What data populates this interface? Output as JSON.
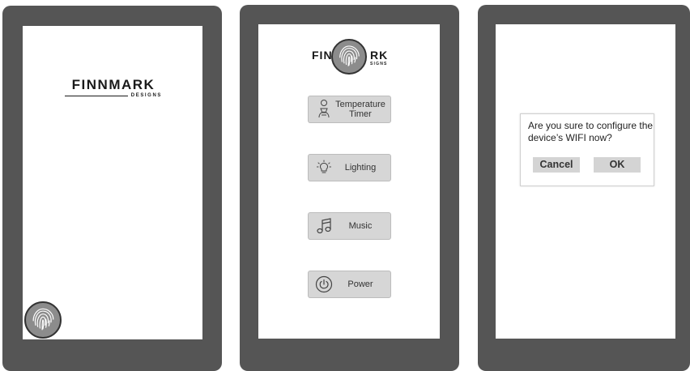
{
  "screens": {
    "splash": {
      "logo": {
        "main": "FINNMARK",
        "sub": "DESIGNS"
      },
      "fingerprint_icon": "fingerprint-icon"
    },
    "menu": {
      "logo": {
        "left": "FIN",
        "right": "RK",
        "sub": "SIGNS"
      },
      "fingerprint_icon": "fingerprint-icon",
      "buttons": [
        {
          "label_line1": "Temperature",
          "label_line2": "Timer",
          "icon": "thermometer-icon"
        },
        {
          "label": "Lighting",
          "icon": "lightbulb-icon"
        },
        {
          "label": "Music",
          "icon": "music-note-icon"
        },
        {
          "label": "Power",
          "icon": "power-icon"
        }
      ]
    },
    "dialog": {
      "message": "Are you sure to configure the device’s WIFI now?",
      "cancel_label": "Cancel",
      "ok_label": "OK"
    }
  },
  "colors": {
    "device_frame": "#555555",
    "screen": "#ffffff",
    "button_bg": "#d6d6d6",
    "text": "#333333"
  }
}
